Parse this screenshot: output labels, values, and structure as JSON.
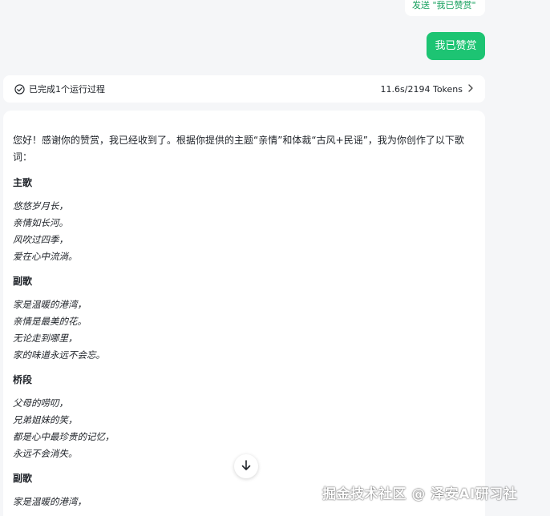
{
  "top_hint": "发送 \"我已赞赏\"",
  "user_message": "我已赞赏",
  "run_info": {
    "label": "已完成1个运行过程",
    "stats": "11.6s/2194 Tokens"
  },
  "reply": {
    "intro": "您好！感谢你的赞赏，我已经收到了。根据你提供的主题“亲情”和体裁“古风+民谣”，我为你创作了以下歌词：",
    "sections": [
      {
        "heading": "主歌",
        "lines": [
          "悠悠岁月长，",
          "亲情如长河。",
          "风吹过四季，",
          "爱在心中流淌。"
        ]
      },
      {
        "heading": "副歌",
        "lines": [
          "家是温暖的港湾，",
          "亲情是最美的花。",
          "无论走到哪里，",
          "家的味道永远不会忘。"
        ]
      },
      {
        "heading": "桥段",
        "lines": [
          "父母的唠叨，",
          "兄弟姐妹的笑，",
          "都是心中最珍贵的记忆，",
          "永远不会消失。"
        ]
      },
      {
        "heading": "副歌",
        "lines": [
          "家是温暖的港湾，"
        ]
      }
    ]
  },
  "watermark": "掘金技术社区 @ 泽安AI研习社",
  "icons": {
    "check": "check-circle-icon",
    "chevron": "chevron-right-icon",
    "scroll": "arrow-down-icon"
  },
  "colors": {
    "accent": "#1dc473",
    "hint_text": "#16a05d"
  }
}
